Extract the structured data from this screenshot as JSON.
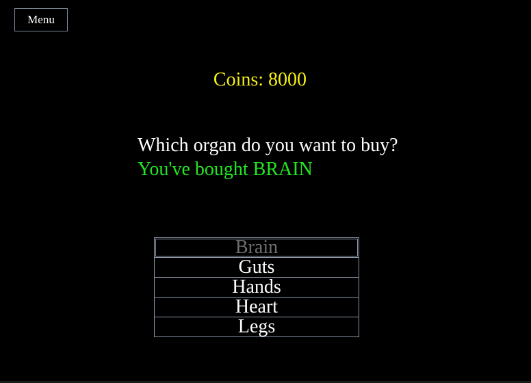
{
  "menu": {
    "label": "Menu"
  },
  "coins": {
    "label": "Coins: 8000"
  },
  "shop": {
    "question": "Which organ do you want to buy?",
    "status": "You've bought BRAIN"
  },
  "organs": [
    {
      "label": "Brain",
      "selected": true
    },
    {
      "label": "Guts"
    },
    {
      "label": "Hands"
    },
    {
      "label": "Heart"
    },
    {
      "label": "Legs"
    }
  ],
  "colors": {
    "background": "#000000",
    "coins": "#f5f014",
    "status": "#22e622",
    "selected_text": "#6e6e6e",
    "border": "#8b96a8"
  }
}
